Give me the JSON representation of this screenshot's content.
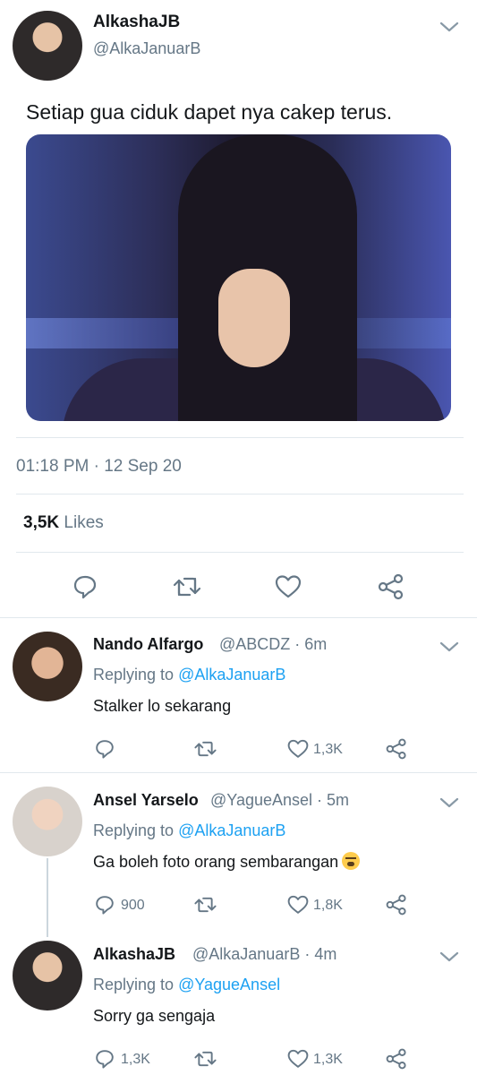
{
  "main_tweet": {
    "name": "AlkashaJB",
    "handle": "@AlkaJanuarB",
    "text": "Setiap gua ciduk dapet nya cakep terus.",
    "timestamp": "01:18 PM · 12 Sep 20",
    "likes_count": "3,5K",
    "likes_label": "Likes"
  },
  "replies": [
    {
      "name": "Nando Alfargo",
      "handle": "@ABCDZ · 6m",
      "replying_prefix": "Replying to ",
      "replying_to": "@AlkaJanuarB",
      "text": "Stalker lo sekarang",
      "reply_count": "",
      "like_count": "1,3K"
    },
    {
      "name": "Ansel Yarselo",
      "handle": "@YagueAnsel · 5m",
      "replying_prefix": "Replying to ",
      "replying_to": "@AlkaJanuarB",
      "text": "Ga boleh foto orang sembarangan",
      "reply_count": "900",
      "like_count": "1,8K"
    },
    {
      "name": "AlkashaJB",
      "handle": "@AlkaJanuarB · 4m",
      "replying_prefix": "Replying to ",
      "replying_to": "@YagueAnsel",
      "text": "Sorry ga sengaja",
      "reply_count": "1,3K",
      "like_count": "1,3K"
    }
  ],
  "colors": {
    "link": "#1da1f2",
    "muted": "#657786",
    "divider": "#e1e8ed"
  }
}
